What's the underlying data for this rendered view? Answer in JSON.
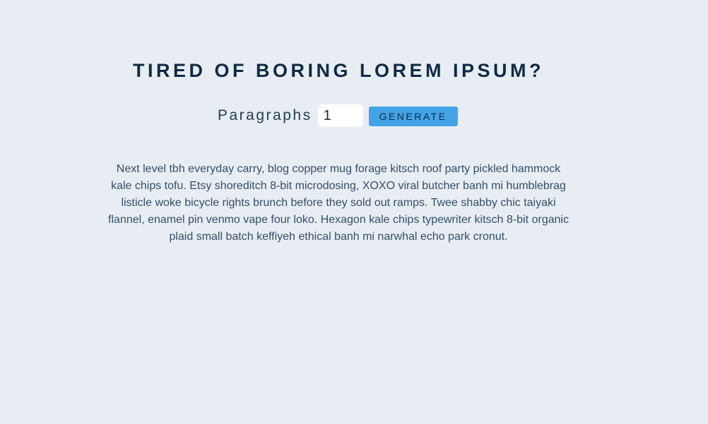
{
  "header": {
    "title": "TIRED OF BORING LOREM IPSUM?"
  },
  "form": {
    "label": "Paragraphs",
    "amount_value": "1",
    "generate_label": "Generate"
  },
  "result": {
    "paragraphs": [
      "Next level tbh everyday carry, blog copper mug forage kitsch roof party pickled hammock kale chips tofu. Etsy shoreditch 8-bit microdosing, XOXO viral butcher banh mi humblebrag listicle woke bicycle rights brunch before they sold out ramps. Twee shabby chic taiyaki flannel, enamel pin venmo vape four loko. Hexagon kale chips typewriter kitsch 8-bit organic plaid small batch keffiyeh ethical banh mi narwhal echo park cronut."
    ]
  },
  "colors": {
    "background": "#e8edf4",
    "title": "#102a43",
    "button": "#42a4e6",
    "text": "#334e68"
  }
}
